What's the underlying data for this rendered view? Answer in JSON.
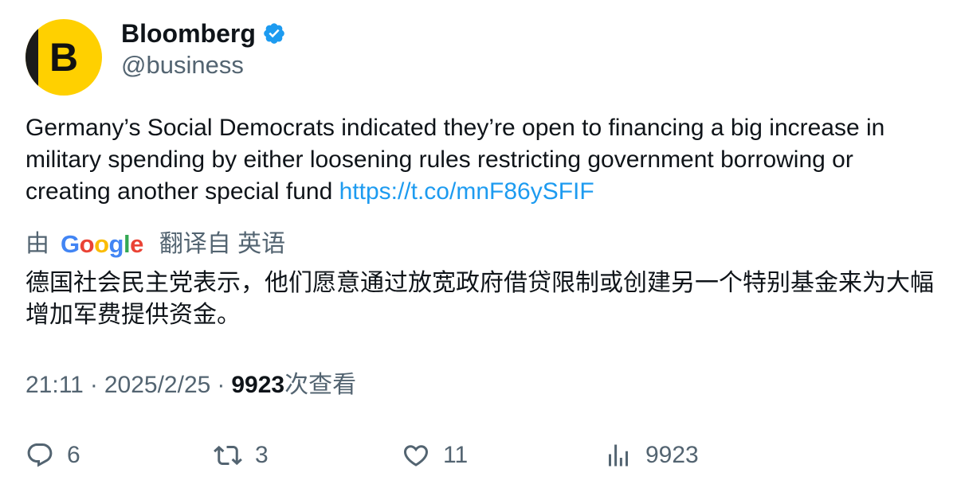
{
  "author": {
    "display_name": "Bloomberg",
    "handle": "@business",
    "avatar_letter": "B",
    "verified": true,
    "avatar_color": "#ffd000"
  },
  "tweet": {
    "text": "Germany’s Social Democrats indicated they’re open to financing a big increase in military spending by either loosening rules restricting government borrowing or creating another special fund ",
    "link": "https://t.co/mnF86ySFIF",
    "link_color": "#1d9bf0"
  },
  "translation": {
    "by_label": "由",
    "provider_logo": "Google",
    "from_label": "翻译自 英语",
    "text": "德国社会民主党表示，他们愿意通过放宽政府借贷限制或创建另一个特别基金来为大幅增加军费提供资金。"
  },
  "meta": {
    "time": "21:11",
    "separator": "·",
    "date": "2025/2/25",
    "views_count": "9923",
    "views_label": "次查看"
  },
  "actions": {
    "replies": {
      "icon": "reply-icon",
      "count": "6"
    },
    "retweets": {
      "icon": "retweet-icon",
      "count": "3"
    },
    "likes": {
      "icon": "heart-icon",
      "count": "11"
    },
    "views": {
      "icon": "analytics-icon",
      "count": "9923"
    }
  }
}
